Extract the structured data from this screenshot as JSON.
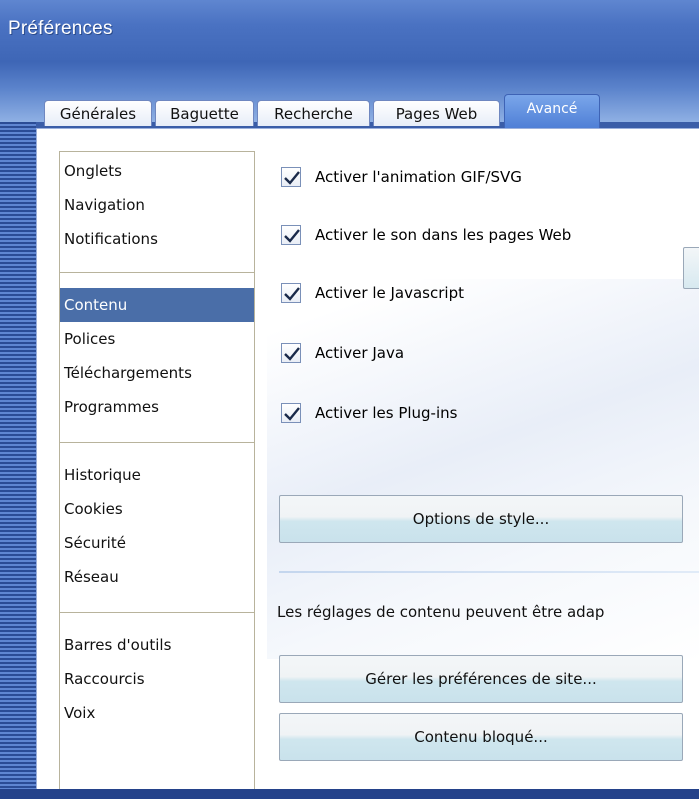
{
  "window": {
    "title": "Préférences"
  },
  "tabs": [
    {
      "label": "Générales",
      "active": false
    },
    {
      "label": "Baguette",
      "active": false
    },
    {
      "label": "Recherche",
      "active": false
    },
    {
      "label": "Pages Web",
      "active": false
    },
    {
      "label": "Avancé",
      "active": true
    }
  ],
  "sidebar": {
    "groups": [
      [
        "Onglets",
        "Navigation",
        "Notifications"
      ],
      [
        "Contenu",
        "Polices",
        "Téléchargements",
        "Programmes"
      ],
      [
        "Historique",
        "Cookies",
        "Sécurité",
        "Réseau"
      ],
      [
        "Barres d'outils",
        "Raccourcis",
        "Voix"
      ]
    ],
    "selected": "Contenu"
  },
  "content": {
    "checkboxes": [
      {
        "label": "Activer l'animation GIF/SVG",
        "checked": true
      },
      {
        "label": "Activer le son dans les pages Web",
        "checked": true
      },
      {
        "label": "Activer le Javascript",
        "checked": true
      },
      {
        "label": "Activer Java",
        "checked": true
      },
      {
        "label": "Activer les Plug-ins",
        "checked": true
      }
    ],
    "style_button": "Options de style...",
    "note": "Les réglages de contenu peuvent être adap",
    "site_prefs_button": "Gérer les préférences de site...",
    "blocked_button": "Contenu bloqué..."
  },
  "colors": {
    "titlebar": "#4a72c2",
    "selection": "#4a6ea8",
    "active_tab": "#5f8ee0",
    "checkmark": "#1a2a4a"
  }
}
